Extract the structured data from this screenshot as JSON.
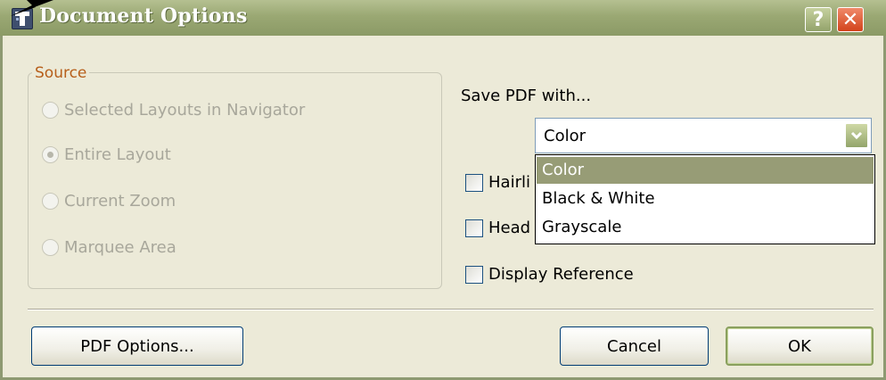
{
  "window": {
    "title": "Document Options",
    "help_label": "?",
    "close_label": "✕"
  },
  "source_group": {
    "legend": "Source",
    "options": [
      {
        "label": "Selected Layouts in Navigator",
        "selected": false
      },
      {
        "label": "Entire Layout",
        "selected": true
      },
      {
        "label": "Current Zoom",
        "selected": false
      },
      {
        "label": "Marquee Area",
        "selected": false
      }
    ]
  },
  "save_pdf": {
    "label": "Save PDF with...",
    "selected_value": "Color",
    "dropdown_options": [
      "Color",
      "Black & White",
      "Grayscale"
    ]
  },
  "checkboxes": [
    {
      "visible_label": "Hairli",
      "checked": false
    },
    {
      "visible_label": "Head",
      "checked": false
    },
    {
      "visible_label": "Display Reference",
      "checked": false
    }
  ],
  "buttons": {
    "pdf_options": "PDF Options...",
    "cancel": "Cancel",
    "ok": "OK"
  },
  "colors": {
    "titlebar": "#9aa873",
    "dialog_bg": "#ecead8",
    "group_legend": "#b75f1b",
    "dropdown_highlight": "#979c76"
  }
}
